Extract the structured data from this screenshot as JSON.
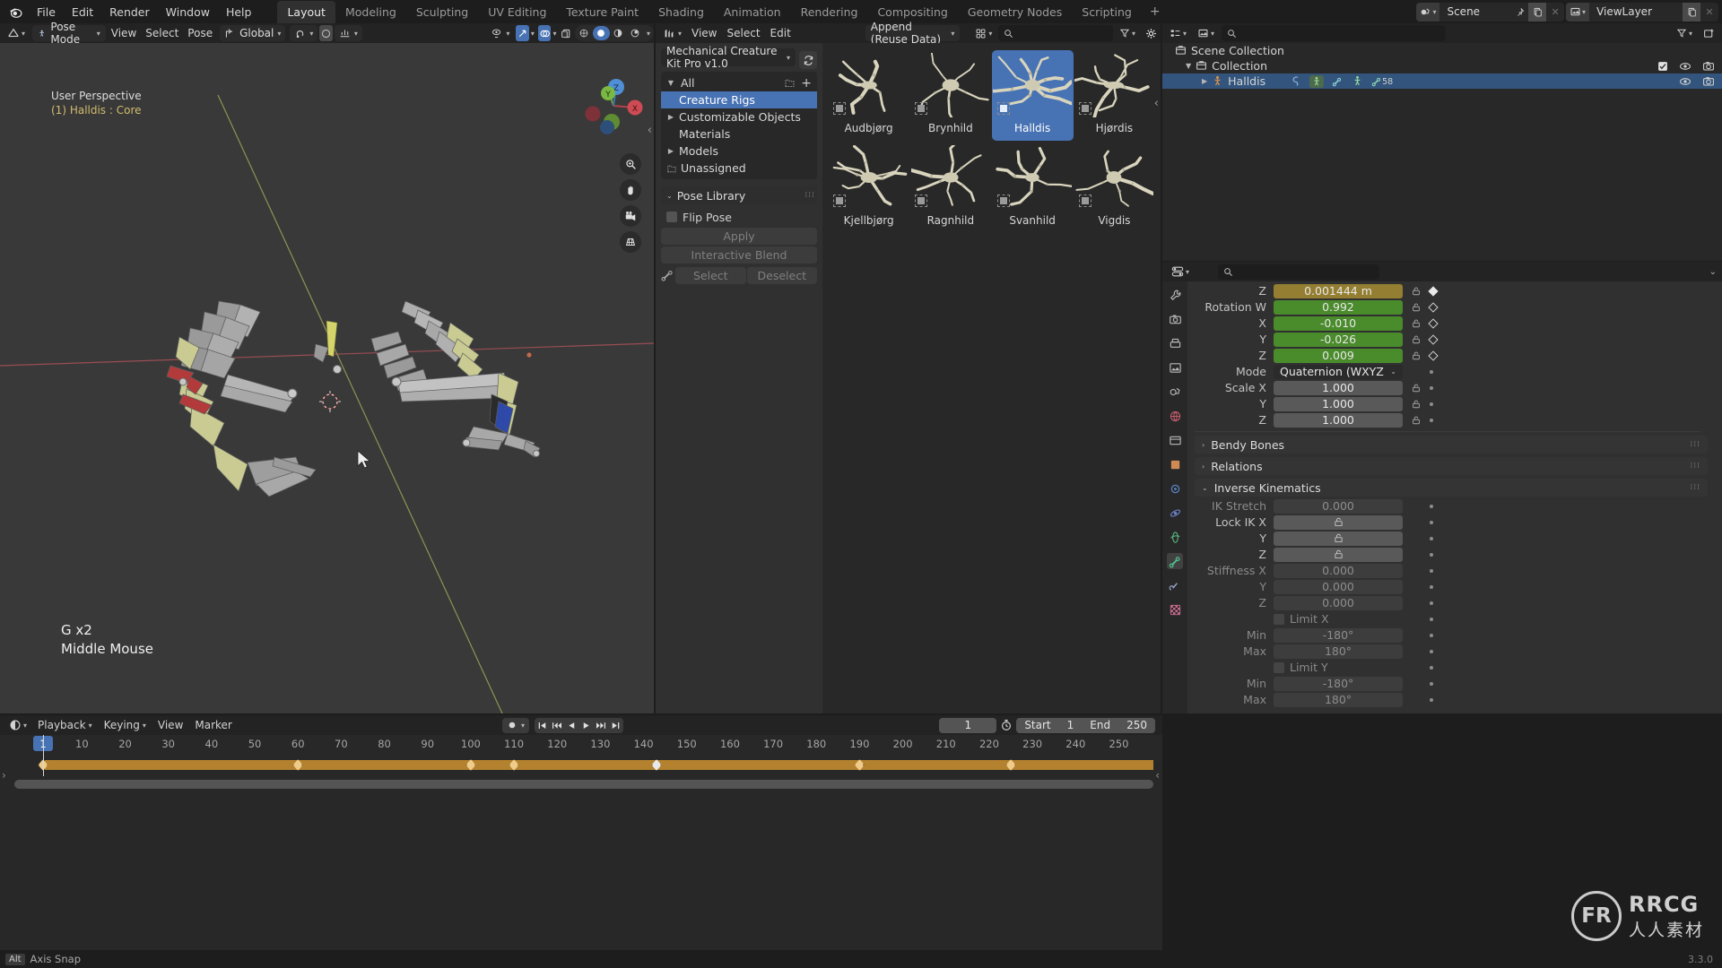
{
  "topbar": {
    "menus": [
      "File",
      "Edit",
      "Render",
      "Window",
      "Help"
    ],
    "workspaces": [
      "Layout",
      "Modeling",
      "Sculpting",
      "UV Editing",
      "Texture Paint",
      "Shading",
      "Animation",
      "Rendering",
      "Compositing",
      "Geometry Nodes",
      "Scripting"
    ],
    "active_workspace": "Layout",
    "add_workspace": "+",
    "scene_name": "Scene",
    "viewlayer_name": "ViewLayer"
  },
  "viewport": {
    "mode": "Pose Mode",
    "menus": [
      "View",
      "Select",
      "Pose"
    ],
    "transform_orientation": "Global",
    "pose_options": "Pose Options",
    "x_button": "X",
    "perspective_label": "User Perspective",
    "object_label": "(1) Halldis : Core",
    "overlay_line1": "G x2",
    "overlay_line2": "Middle Mouse",
    "gizmo_axes": [
      "X",
      "Y",
      "Z"
    ]
  },
  "asset_browser": {
    "editor_menus": [
      "View",
      "Select",
      "Edit"
    ],
    "import_method": "Append (Reuse Data)",
    "search_placeholder": "",
    "library": "Mechanical Creature Kit Pro v1.0",
    "catalogs": [
      {
        "label": "All",
        "indent": 0,
        "arrow": "down",
        "selected": false
      },
      {
        "label": "Creature Rigs",
        "indent": 1,
        "arrow": "none",
        "selected": true
      },
      {
        "label": "Customizable Objects",
        "indent": 1,
        "arrow": "right",
        "selected": false
      },
      {
        "label": "Materials",
        "indent": 1,
        "arrow": "none",
        "selected": false
      },
      {
        "label": "Models",
        "indent": 1,
        "arrow": "right",
        "selected": false
      },
      {
        "label": "Unassigned",
        "indent": 0,
        "arrow": "none",
        "selected": false
      }
    ],
    "pose_library": {
      "title": "Pose Library",
      "flip_pose_label": "Flip Pose",
      "flip_pose_checked": false,
      "apply": "Apply",
      "interactive_blend": "Interactive Blend",
      "select": "Select",
      "deselect": "Deselect"
    },
    "assets": [
      {
        "name": "Audbjørg",
        "selected": false
      },
      {
        "name": "Brynhild",
        "selected": false
      },
      {
        "name": "Halldis",
        "selected": true
      },
      {
        "name": "Hjørdis",
        "selected": false
      },
      {
        "name": "Kjellbjørg",
        "selected": false
      },
      {
        "name": "Ragnhild",
        "selected": false
      },
      {
        "name": "Svanhild",
        "selected": false
      },
      {
        "name": "Vigdis",
        "selected": false
      }
    ]
  },
  "outliner": {
    "search_placeholder": "",
    "rows": [
      {
        "label": "Scene Collection",
        "indent": 0,
        "icon": "collection-icon",
        "selected": false,
        "has_toggles": false
      },
      {
        "label": "Collection",
        "indent": 1,
        "icon": "collection-icon",
        "selected": false,
        "has_toggles": true,
        "checkbox": true
      },
      {
        "label": "Halldis",
        "indent": 2,
        "icon": "armature-icon",
        "selected": true,
        "has_toggles": true,
        "bone_count": "58"
      }
    ]
  },
  "properties": {
    "search_placeholder": "",
    "fields": [
      {
        "label": "Z",
        "value": "0.001444 m",
        "style": "yellow",
        "lock": true,
        "key": "filled"
      },
      {
        "label": "Rotation W",
        "value": "0.992",
        "style": "green",
        "lock": true,
        "key": "open"
      },
      {
        "label": "X",
        "value": "-0.010",
        "style": "green",
        "lock": true,
        "key": "open"
      },
      {
        "label": "Y",
        "value": "-0.026",
        "style": "green",
        "lock": true,
        "key": "open"
      },
      {
        "label": "Z",
        "value": "0.009",
        "style": "green",
        "lock": true,
        "key": "open"
      },
      {
        "label": "Mode",
        "value": "Quaternion (WXYZ",
        "style": "dropdown",
        "lock": false,
        "key": "dot"
      },
      {
        "label": "Scale X",
        "value": "1.000",
        "style": "grey",
        "lock": true,
        "key": "dot"
      },
      {
        "label": "Y",
        "value": "1.000",
        "style": "grey",
        "lock": true,
        "key": "dot"
      },
      {
        "label": "Z",
        "value": "1.000",
        "style": "grey",
        "lock": true,
        "key": "dot"
      }
    ],
    "sections": [
      {
        "label": "Bendy Bones",
        "open": false
      },
      {
        "label": "Relations",
        "open": false
      },
      {
        "label": "Inverse Kinematics",
        "open": true
      }
    ],
    "ik_fields": [
      {
        "label": "IK Stretch",
        "value": "0.000",
        "style": "dim",
        "dim_label": true,
        "key": "dot"
      },
      {
        "label": "Lock IK X",
        "value": "lock-icon",
        "style": "grey",
        "key": "dot"
      },
      {
        "label": "Y",
        "value": "lock-icon",
        "style": "grey",
        "key": "dot"
      },
      {
        "label": "Z",
        "value": "lock-icon",
        "style": "grey",
        "key": "dot"
      },
      {
        "label": "Stiffness X",
        "value": "0.000",
        "style": "dim",
        "dim_label": true,
        "key": "dot"
      },
      {
        "label": "Y",
        "value": "0.000",
        "style": "dim",
        "dim_label": true,
        "key": "dot"
      },
      {
        "label": "Z",
        "value": "0.000",
        "style": "dim",
        "dim_label": true,
        "key": "dot"
      },
      {
        "label": "",
        "value": "Limit X",
        "style": "checkbox",
        "key": "dot"
      },
      {
        "label": "Min",
        "value": "-180°",
        "style": "dim",
        "dim_label": true,
        "key": "dot"
      },
      {
        "label": "Max",
        "value": "180°",
        "style": "dim",
        "dim_label": true,
        "key": "dot"
      },
      {
        "label": "",
        "value": "Limit Y",
        "style": "checkbox",
        "key": "dot"
      },
      {
        "label": "Min",
        "value": "-180°",
        "style": "dim",
        "dim_label": true,
        "key": "dot"
      },
      {
        "label": "Max",
        "value": "180°",
        "style": "dim",
        "dim_label": true,
        "key": "dot"
      }
    ]
  },
  "timeline": {
    "menus": [
      "Playback",
      "Keying",
      "View",
      "Marker"
    ],
    "current_frame": "1",
    "start_label": "Start",
    "start_value": "1",
    "end_label": "End",
    "end_value": "250",
    "tick_labels": [
      "1",
      "10",
      "20",
      "30",
      "40",
      "50",
      "60",
      "70",
      "80",
      "90",
      "100",
      "110",
      "120",
      "130",
      "140",
      "150",
      "160",
      "170",
      "180",
      "190",
      "200",
      "210",
      "220",
      "230",
      "240",
      "250"
    ],
    "keyframes": [
      {
        "frame": 1,
        "selected": false
      },
      {
        "frame": 60,
        "selected": false
      },
      {
        "frame": 100,
        "selected": false
      },
      {
        "frame": 110,
        "selected": false
      },
      {
        "frame": 143,
        "selected": true
      },
      {
        "frame": 190,
        "selected": false
      },
      {
        "frame": 225,
        "selected": false
      }
    ],
    "range_start": 1,
    "range_end": 258
  },
  "status": {
    "key_hint": "Alt",
    "action": "Axis Snap",
    "version": "3.3.0"
  },
  "watermark": {
    "logo": "FR",
    "name": "RRCG",
    "subtitle": "人人素材"
  },
  "colors": {
    "accent_blue": "#4772b3",
    "keyframe": "#f0cb88",
    "channel_bar": "#b4822f",
    "yellow_field": "#947e31",
    "green_field": "#4a8b2c"
  }
}
